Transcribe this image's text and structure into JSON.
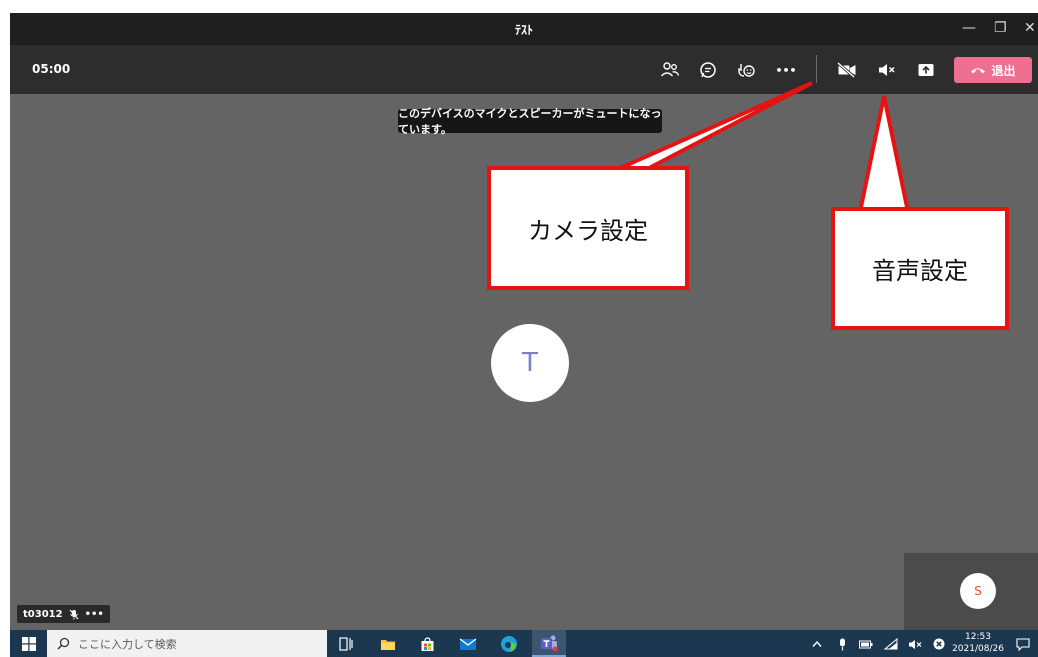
{
  "window": {
    "title": "ﾃｽﾄ",
    "minimize_glyph": "—",
    "maximize_glyph": "❐",
    "close_glyph": "✕"
  },
  "toolbar": {
    "timer": "05:00",
    "more_glyph": "•••",
    "leave_label": "退出"
  },
  "notification": {
    "text": "このデバイスのマイクとスピーカーがミュートになっています。"
  },
  "stage": {
    "main_avatar_initial": "T",
    "self_avatar_initial": "S",
    "self_name": "t03012",
    "self_more_glyph": "•••"
  },
  "annotations": {
    "camera_label": "カメラ設定",
    "audio_label": "音声設定",
    "color": "#e51413"
  },
  "taskbar": {
    "search_placeholder": "ここに入力して検索",
    "time": "12:53",
    "date": "2021/08/26"
  },
  "colors": {
    "titlebar": "#1f1f1f",
    "toolbar": "#2d2d2d",
    "stage": "#646464",
    "leave_button": "#ee6f8f",
    "taskbar": "#1c3750"
  }
}
